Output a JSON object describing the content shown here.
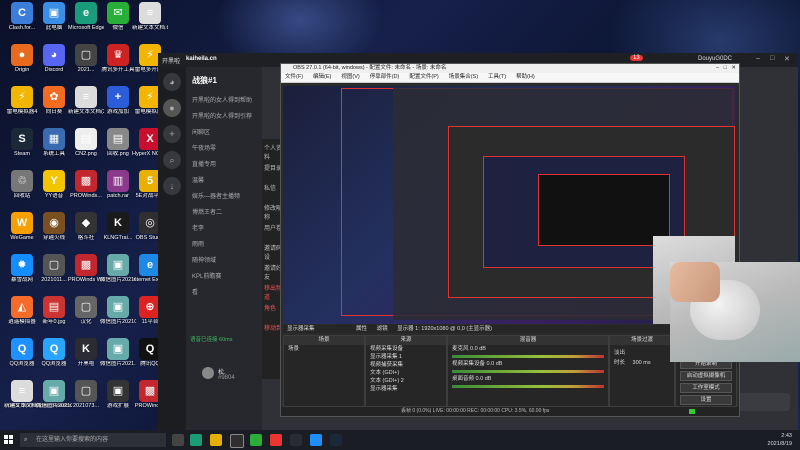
{
  "desktop_icons": [
    {
      "label": "Clash.for...",
      "glyph": "C",
      "color": "#3b7dd8"
    },
    {
      "label": "此电脑",
      "glyph": "▣",
      "color": "#3a8ee6"
    },
    {
      "label": "Microsoft Edge",
      "glyph": "e",
      "color": "#1a9b7a"
    },
    {
      "label": "微信",
      "glyph": "✉",
      "color": "#2aae3a"
    },
    {
      "label": "新建文本文档.txt",
      "glyph": "≡",
      "color": "#dcdcdc"
    },
    {
      "label": "Origin",
      "glyph": "●",
      "color": "#e86a1c"
    },
    {
      "label": "Discord",
      "glyph": "◕",
      "color": "#5865f2"
    },
    {
      "label": "2021...",
      "glyph": "▢",
      "color": "#444"
    },
    {
      "label": "腾讯多开工具",
      "glyph": "♛",
      "color": "#c22"
    },
    {
      "label": "雷电多开器4",
      "glyph": "⚡",
      "color": "#f2b600"
    },
    {
      "label": "雷电模拟器4",
      "glyph": "⚡",
      "color": "#f2b600"
    },
    {
      "label": "向日葵",
      "glyph": "✿",
      "color": "#f36b21"
    },
    {
      "label": "新建文本文档(2).txt",
      "glyph": "≡",
      "color": "#dcdcdc"
    },
    {
      "label": "游戏加加",
      "glyph": "+",
      "color": "#2b5dd8"
    },
    {
      "label": "雷电模拟器4",
      "glyph": "⚡",
      "color": "#f2b600"
    },
    {
      "label": "Steam",
      "glyph": "S",
      "color": "#1b2838"
    },
    {
      "label": "系统工具",
      "glyph": "▦",
      "color": "#3a6bb0"
    },
    {
      "label": "CN2.png",
      "glyph": "▤",
      "color": "#eeeeee"
    },
    {
      "label": "回收.png",
      "glyph": "▤",
      "color": "#888"
    },
    {
      "label": "HyperX NGenuity",
      "glyph": "X",
      "color": "#c8102e"
    },
    {
      "label": "回收站",
      "glyph": "♲",
      "color": "#777"
    },
    {
      "label": "YY语音",
      "glyph": "Y",
      "color": "#f5c400"
    },
    {
      "label": "PROWinds...",
      "glyph": "▩",
      "color": "#c1272d"
    },
    {
      "label": "patch.rar",
      "glyph": "▥",
      "color": "#8b3a8b"
    },
    {
      "label": "5E对战平台",
      "glyph": "5",
      "color": "#e8b000"
    },
    {
      "label": "WeGame",
      "glyph": "W",
      "color": "#f5a000"
    },
    {
      "label": "穿越火线",
      "glyph": "◉",
      "color": "#7a5020"
    },
    {
      "label": "格斗社",
      "glyph": "◆",
      "color": "#333"
    },
    {
      "label": "KLNGTrai...",
      "glyph": "K",
      "color": "#1a1a1a"
    },
    {
      "label": "OBS Studio",
      "glyph": "◎",
      "color": "#302e31"
    },
    {
      "label": "暴雪战网",
      "glyph": "✹",
      "color": "#148eff"
    },
    {
      "label": "2021011...",
      "glyph": "▢",
      "color": "#555"
    },
    {
      "label": "PROWinds WeGame截图",
      "glyph": "▩",
      "color": "#c1272d"
    },
    {
      "label": "微信图片2021070...",
      "glyph": "▣",
      "color": "#6aa"
    },
    {
      "label": "Internet Explorer",
      "glyph": "e",
      "color": "#1e88e5"
    },
    {
      "label": "逍遥模拟器",
      "glyph": "◭",
      "color": "#f56c2a"
    },
    {
      "label": "新年0.jpg",
      "glyph": "▤",
      "color": "#c33"
    },
    {
      "label": "汉化",
      "glyph": "▢",
      "color": "#666"
    },
    {
      "label": "微信图片2021070...",
      "glyph": "▣",
      "color": "#6aa"
    },
    {
      "label": "11平台",
      "glyph": "⊕",
      "color": "#d22"
    },
    {
      "label": "QQ浏览器",
      "glyph": "Q",
      "color": "#1e90ff"
    },
    {
      "label": "QQ浏览器",
      "glyph": "Q",
      "color": "#2aa5ff"
    },
    {
      "label": "开黑啦",
      "glyph": "K",
      "color": "#2a2c31"
    },
    {
      "label": "微信图片2021...",
      "glyph": "▣",
      "color": "#6aa"
    },
    {
      "label": "腾讯QQ",
      "glyph": "Q",
      "color": "#111"
    },
    {
      "label": "OBS Studio",
      "glyph": "◎",
      "color": "#302e31"
    },
    {
      "label": "Open Broadcast...",
      "glyph": "◎",
      "color": "#302e31"
    },
    {
      "label": "2021073...",
      "glyph": "▢",
      "color": "#555"
    },
    {
      "label": "游戏扩展",
      "glyph": "▣",
      "color": "#333"
    },
    {
      "label": "PROWinds4",
      "glyph": "▩",
      "color": "#c1272d"
    },
    {
      "label": "新建文本文档.txt",
      "glyph": "≡",
      "color": "#dcdcdc"
    },
    {
      "label": "微信图片2021073...",
      "glyph": "▣",
      "color": "#6aa"
    }
  ],
  "kaiheila": {
    "app_name": "开黑啦",
    "domain": "kaiheila.cn",
    "server_title": "战狼#1",
    "window_user": "DouyuG0DC",
    "notif_count": "13",
    "channels": [
      "开黑啦的女人得到帮助",
      "开黑啦的女人得到引荐",
      "闲聊区",
      "午夜场零",
      "直播专用",
      "温馨",
      "娱乐—器者主播频",
      "博燃王者二",
      "老李",
      "雨雨",
      "随神领域",
      "KPL前瞻赛",
      "看"
    ],
    "voice_status": "语音已连接 60ms",
    "user_name": "松.",
    "user_id": "#9804",
    "menu_items": [
      "个人资料",
      "提目录",
      "私信",
      "修改昵称",
      "用户卷",
      "邀请码设",
      "邀请好友",
      "移出频道",
      "角色",
      "移动到"
    ]
  },
  "obs": {
    "title": "OBS 27.0.1 (64-bit, windows) - 配置文件: 未命名 - 场景: 未命名",
    "menu": [
      "文件(F)",
      "编辑(E)",
      "视图(V)",
      "停靠部件(D)",
      "配置文件(P)",
      "场景集合(S)",
      "工具(T)",
      "帮助(H)"
    ],
    "display_label": "显示器采集",
    "toolbar": {
      "props": "属性",
      "filters": "滤镜",
      "display": "显示器 1: 1920x1080 @ 0,0 (主显示器)"
    },
    "scenes_header": "场景",
    "scenes": [
      "场景"
    ],
    "sources_header": "来源",
    "sources": [
      "视频采集设备",
      "显示器采集 1",
      "视频捕获采集",
      "文本 (GDI+)",
      "文本 (GDI+) 2",
      "显示器采集"
    ],
    "mixer_header": "混音器",
    "mixer": [
      {
        "name": "麦克风",
        "db": "0.0 dB"
      },
      {
        "name": "视频采集设备",
        "db": "0.0 dB"
      },
      {
        "name": "桌面音频",
        "db": "0.0 dB"
      }
    ],
    "transitions_header": "场景过渡",
    "transition_type": "淡出",
    "duration_label": "时长",
    "duration_value": "300 ms",
    "controls_header": "控制",
    "controls": [
      "开始推流",
      "开始录制",
      "启动虚拟摄像机",
      "工作室模式",
      "设置",
      "退出"
    ],
    "status": "丢帧 0 (0.0%)   LIVE: 00:00:00   REC: 00:00:00   CPU: 3.5%, 60.00 fps"
  },
  "taskbar": {
    "search_placeholder": "在这里输入你要搜索的内容",
    "time": "2:43",
    "date": "2021/8/19"
  }
}
